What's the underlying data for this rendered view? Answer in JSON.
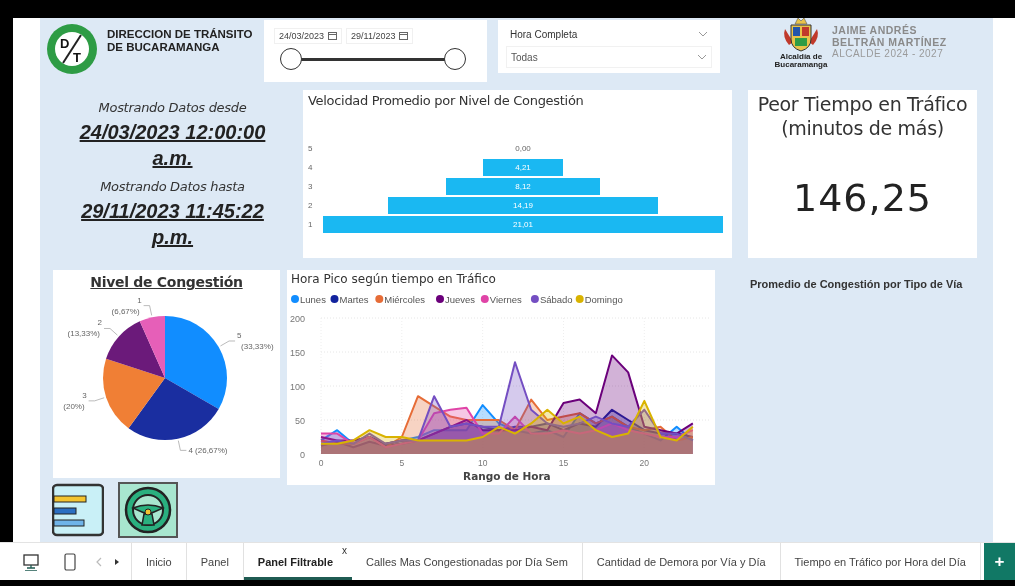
{
  "header": {
    "logo_letters": [
      "D",
      "T"
    ],
    "agency": "DIRECCION DE TRÁNSITO DE BUCARAMANGA",
    "date_slicer": {
      "start": "24/03/2023",
      "end": "29/11/2023",
      "level": 1
    },
    "dropdowns": [
      {
        "value": "Hora Completa"
      },
      {
        "value": "Todas"
      }
    ],
    "crest_caption": "Alcaldía de Bucaramanga",
    "mayor_name": [
      "JAIME ANDRÉS",
      "BELTRÁN MARTÍNEZ"
    ],
    "mayor_role": "ALCALDE 2024 - 2027"
  },
  "date_range": {
    "from_label": "Mostrando Datos desde",
    "from": "24/03/2023 12:00:00 a.m.",
    "to_label": "Mostrando Datos hasta",
    "to": "29/11/2023 11:45:22 p.m."
  },
  "speed_chart": {
    "title": "Velocidad Promedio por Nivel de Congestión",
    "rows": [
      {
        "category": "5",
        "value_label": "0,00"
      },
      {
        "category": "4",
        "value_label": "4,21"
      },
      {
        "category": "3",
        "value_label": "8,12"
      },
      {
        "category": "2",
        "value_label": "14,19"
      },
      {
        "category": "1",
        "value_label": "21,01"
      }
    ]
  },
  "kpi": {
    "title": "Peor Tiempo en Tráfico (minutos de más)",
    "value": "146,25"
  },
  "congestion_pie": {
    "chart_data": {
      "type": "pie",
      "title": "Nivel de Congestión",
      "categories": [
        "5",
        "4",
        "3",
        "2",
        "1"
      ],
      "values": [
        33.33,
        26.67,
        20,
        13.33,
        6.67
      ],
      "colors": [
        "#118dff",
        "#1a2ea0",
        "#f07f35",
        "#6b1a7a",
        "#e65fb8"
      ],
      "value_labels": [
        "(33,33%)",
        "(26,67%)",
        "(20%)",
        "(13,33%)",
        "(6,67%)"
      ]
    }
  },
  "peak_chart": {
    "chart_data": {
      "type": "area",
      "title": "Hora Pico según tiempo en Tráfico",
      "xlabel": "Rango de Hora",
      "x": [
        0,
        1,
        2,
        3,
        4,
        5,
        6,
        7,
        8,
        9,
        10,
        11,
        12,
        13,
        14,
        15,
        16,
        17,
        18,
        19,
        20,
        21,
        22,
        23
      ],
      "xticks": [
        0,
        5,
        10,
        15,
        20
      ],
      "yticks": [
        0,
        50,
        100,
        150,
        200
      ],
      "xlim": [
        0,
        24
      ],
      "ylim": [
        0,
        200
      ],
      "grid": true,
      "legend": "top",
      "series": [
        {
          "name": "Lunes",
          "color": "#118dff",
          "values": [
            20,
            35,
            15,
            25,
            15,
            20,
            25,
            35,
            35,
            35,
            72,
            45,
            35,
            30,
            35,
            25,
            60,
            45,
            55,
            40,
            30,
            20,
            40,
            20
          ]
        },
        {
          "name": "Martes",
          "color": "#12239e",
          "values": [
            12,
            18,
            10,
            18,
            12,
            15,
            20,
            30,
            40,
            45,
            40,
            35,
            40,
            40,
            45,
            35,
            45,
            40,
            65,
            50,
            35,
            30,
            30,
            25
          ]
        },
        {
          "name": "Miércoles",
          "color": "#e66c37",
          "values": [
            20,
            15,
            15,
            25,
            10,
            25,
            85,
            70,
            55,
            50,
            50,
            50,
            35,
            80,
            50,
            55,
            60,
            45,
            55,
            40,
            35,
            40,
            20,
            25
          ]
        },
        {
          "name": "Jueves",
          "color": "#6b007b",
          "values": [
            25,
            20,
            20,
            25,
            15,
            20,
            20,
            30,
            40,
            50,
            35,
            35,
            35,
            40,
            35,
            75,
            80,
            60,
            145,
            120,
            40,
            35,
            30,
            45
          ]
        },
        {
          "name": "Viernes",
          "color": "#e044a7",
          "values": [
            30,
            30,
            15,
            25,
            10,
            15,
            20,
            60,
            65,
            68,
            30,
            30,
            55,
            30,
            30,
            35,
            30,
            35,
            45,
            35,
            30,
            25,
            25,
            35
          ]
        },
        {
          "name": "Sábado",
          "color": "#744ec2",
          "values": [
            15,
            20,
            15,
            30,
            15,
            20,
            20,
            85,
            40,
            45,
            40,
            40,
            135,
            65,
            45,
            40,
            45,
            55,
            45,
            40,
            65,
            30,
            30,
            20
          ]
        },
        {
          "name": "Domingo",
          "color": "#d9b300",
          "values": [
            15,
            15,
            20,
            35,
            25,
            25,
            20,
            20,
            20,
            20,
            25,
            40,
            30,
            45,
            65,
            45,
            55,
            35,
            25,
            30,
            78,
            25,
            20,
            40
          ]
        }
      ]
    }
  },
  "road_type_title": "Promedio de Congestión por Tipo de Vía",
  "page_tabs": {
    "tabs": [
      {
        "label": "Inicio",
        "selected": false
      },
      {
        "label": "Panel",
        "selected": false
      },
      {
        "label": "Panel Filtrable",
        "selected": true
      },
      {
        "label": "Calles Mas Congestionadas por Día Sem",
        "selected": false
      },
      {
        "label": "Cantidad de Demora por Vía y Día",
        "selected": false
      },
      {
        "label": "Tiempo en Tráfico por Hora del Día",
        "selected": false
      }
    ],
    "close_glyph": "x",
    "add_glyph": "+"
  }
}
